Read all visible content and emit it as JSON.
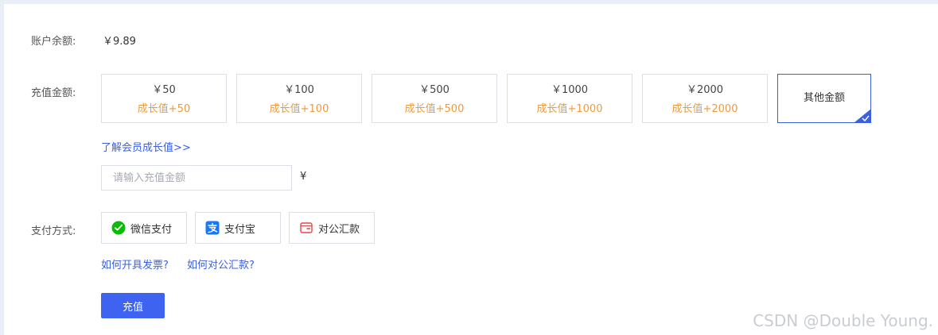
{
  "balance": {
    "label": "账户余额:",
    "value": "￥9.89"
  },
  "recharge": {
    "label": "充值金额:",
    "options": [
      {
        "price": "￥50",
        "growth": "成长值+50"
      },
      {
        "price": "￥100",
        "growth": "成长值+100"
      },
      {
        "price": "￥500",
        "growth": "成长值+500"
      },
      {
        "price": "￥1000",
        "growth": "成长值+1000"
      },
      {
        "price": "￥2000",
        "growth": "成长值+2000"
      }
    ],
    "other_label": "其他金额",
    "selected": "其他金额",
    "learn_link": "了解会员成长值>>",
    "input_placeholder": "请输入充值金额",
    "input_value": "",
    "currency_unit": "¥"
  },
  "payment": {
    "label": "支付方式:",
    "methods": [
      {
        "label": "微信支付",
        "icon": "wechat-pay-icon"
      },
      {
        "label": "支付宝",
        "icon": "alipay-icon"
      },
      {
        "label": "对公汇款",
        "icon": "wallet-icon"
      }
    ],
    "help_links": [
      "如何开具发票?",
      "如何对公汇款?"
    ]
  },
  "submit": {
    "label": "充值"
  },
  "watermark": "CSDN @Double Young.",
  "colors": {
    "accent": "#3d63f0",
    "growth": "#ef9a3a",
    "wechat": "#09bb07",
    "alipay": "#1677ff",
    "transfer": "#e64545"
  }
}
